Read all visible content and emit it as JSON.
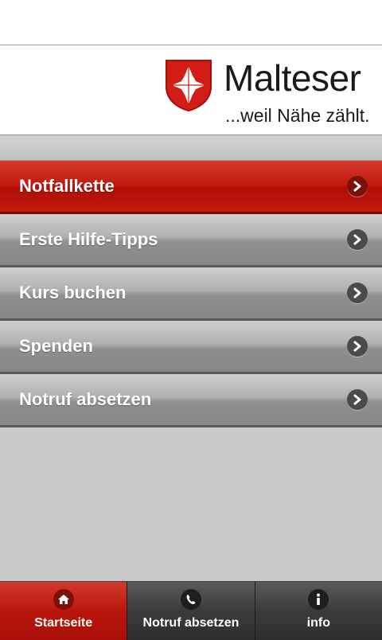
{
  "header": {
    "brand": "Malteser",
    "tagline": "...weil Nähe zählt."
  },
  "menu": {
    "items": [
      {
        "label": "Notfallkette",
        "active": true
      },
      {
        "label": "Erste Hilfe-Tipps",
        "active": false
      },
      {
        "label": "Kurs buchen",
        "active": false
      },
      {
        "label": "Spenden",
        "active": false
      },
      {
        "label": "Notruf absetzen",
        "active": false
      }
    ]
  },
  "tabs": [
    {
      "label": "Startseite",
      "icon": "home-icon",
      "active": true
    },
    {
      "label": "Notruf absetzen",
      "icon": "phone-icon",
      "active": false
    },
    {
      "label": "info",
      "icon": "info-icon",
      "active": false
    }
  ],
  "colors": {
    "brand_red": "#c41a10",
    "menu_gray": "#a0a0a0",
    "tab_dark": "#3b3b3b"
  }
}
